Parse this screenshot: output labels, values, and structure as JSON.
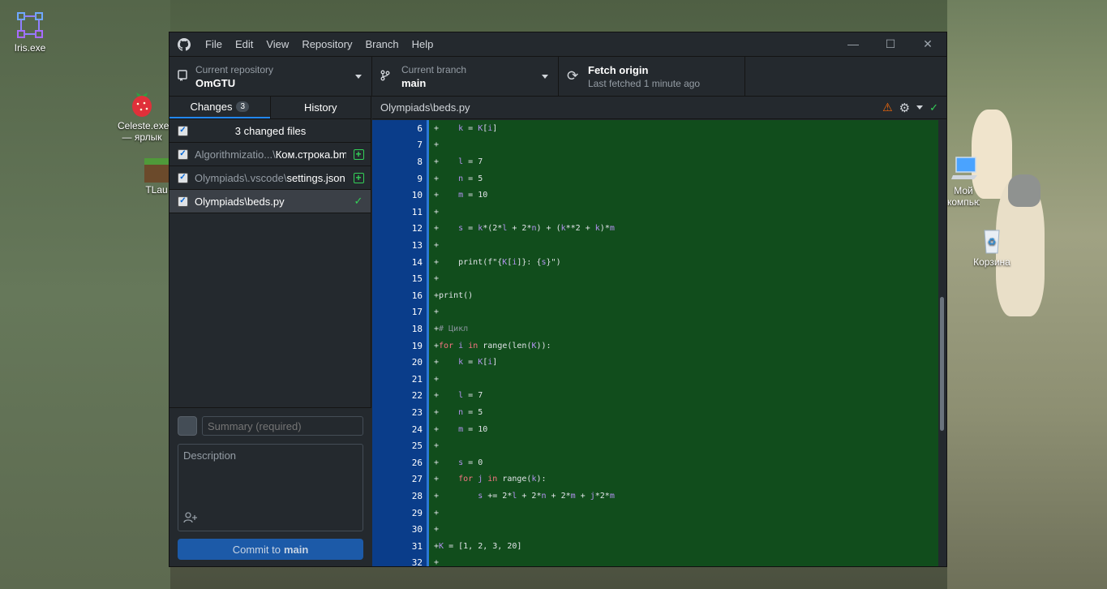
{
  "desktop": {
    "icons": [
      {
        "label": "Iris.exe"
      },
      {
        "label": "Celeste.exe — ярлык"
      },
      {
        "label": "TLau"
      },
      {
        "label": "Мой компьютер"
      },
      {
        "label": "Корзина"
      }
    ]
  },
  "menu": [
    "File",
    "Edit",
    "View",
    "Repository",
    "Branch",
    "Help"
  ],
  "toolbar": {
    "repo_label": "Current repository",
    "repo_value": "OmGTU",
    "branch_label": "Current branch",
    "branch_value": "main",
    "fetch_label": "Fetch origin",
    "fetch_sub": "Last fetched 1 minute ago"
  },
  "tabs": {
    "changes": "Changes",
    "changes_count": "3",
    "history": "History"
  },
  "changed_header": "3 changed files",
  "files": [
    {
      "dir": "Algorithmizatio...\\",
      "name": "Ком.строка.bmp",
      "status": "added"
    },
    {
      "dir": "Olympiads\\.vscode\\",
      "name": "settings.json",
      "status": "added"
    },
    {
      "dir": "Olympiads\\",
      "name": "beds.py",
      "status": "modified"
    }
  ],
  "commit": {
    "summary_placeholder": "Summary (required)",
    "description_placeholder": "Description",
    "button_prefix": "Commit to",
    "button_branch": "main"
  },
  "diff": {
    "path": "Olympiads\\beds.py",
    "lines": [
      {
        "n": "6",
        "t": "+    k = K[i]"
      },
      {
        "n": "7",
        "t": "+"
      },
      {
        "n": "8",
        "t": "+    l = 7"
      },
      {
        "n": "9",
        "t": "+    n = 5"
      },
      {
        "n": "10",
        "t": "+    m = 10"
      },
      {
        "n": "11",
        "t": "+"
      },
      {
        "n": "12",
        "t": "+    s = k*(2*l + 2*n) + (k**2 + k)*m"
      },
      {
        "n": "13",
        "t": "+"
      },
      {
        "n": "14",
        "t": "+    print(f\"{K[i]}: {s}\")"
      },
      {
        "n": "15",
        "t": "+"
      },
      {
        "n": "16",
        "t": "+print()"
      },
      {
        "n": "17",
        "t": "+"
      },
      {
        "n": "18",
        "t": "+# Цикл"
      },
      {
        "n": "19",
        "t": "+for i in range(len(K)):"
      },
      {
        "n": "20",
        "t": "+    k = K[i]"
      },
      {
        "n": "21",
        "t": "+"
      },
      {
        "n": "22",
        "t": "+    l = 7"
      },
      {
        "n": "23",
        "t": "+    n = 5"
      },
      {
        "n": "24",
        "t": "+    m = 10"
      },
      {
        "n": "25",
        "t": "+"
      },
      {
        "n": "26",
        "t": "+    s = 0"
      },
      {
        "n": "27",
        "t": "+    for j in range(k):"
      },
      {
        "n": "28",
        "t": "+        s += 2*l + 2*n + 2*m + j*2*m"
      },
      {
        "n": "29",
        "t": "+"
      },
      {
        "n": "30",
        "t": "+"
      },
      {
        "n": "31",
        "t": "+K = [1, 2, 3, 20]"
      },
      {
        "n": "32",
        "t": "+"
      }
    ]
  }
}
